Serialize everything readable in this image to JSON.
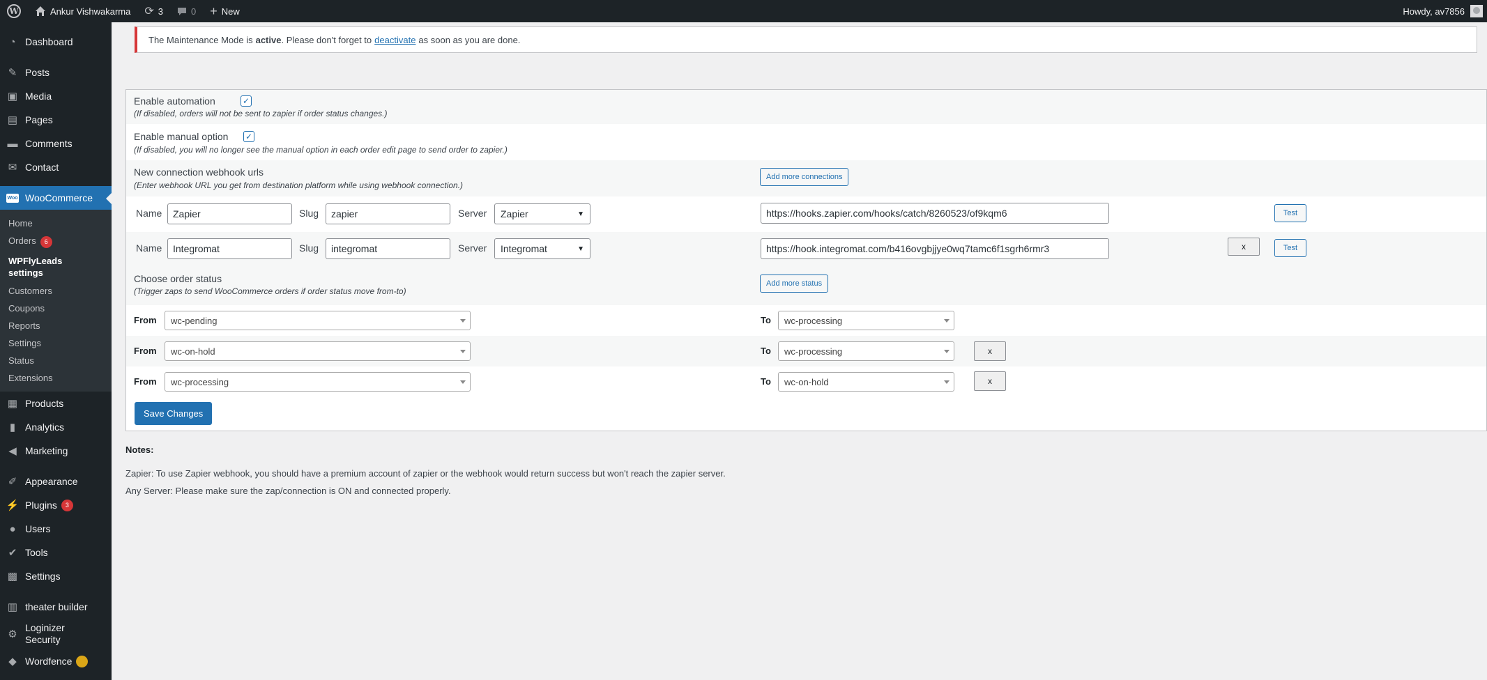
{
  "adminbar": {
    "site_name": "Ankur Vishwakarma",
    "updates_count": "3",
    "comments_count": "0",
    "new_label": "New",
    "howdy": "Howdy, av7856"
  },
  "sidebar": {
    "items_top": [
      {
        "label": "Dashboard",
        "icon": "dashboard-icon"
      }
    ],
    "items_content": [
      {
        "label": "Posts",
        "icon": "pin-icon"
      },
      {
        "label": "Media",
        "icon": "media-icon"
      },
      {
        "label": "Pages",
        "icon": "page-icon"
      },
      {
        "label": "Comments",
        "icon": "comment-icon"
      },
      {
        "label": "Contact",
        "icon": "mail-icon"
      }
    ],
    "woocommerce_label": "WooCommerce",
    "woo_icon_text": "Woo",
    "woo_submenu": {
      "home": "Home",
      "orders": "Orders",
      "orders_badge": "6",
      "wpflyleads": "WPFlyLeads settings",
      "customers": "Customers",
      "coupons": "Coupons",
      "reports": "Reports",
      "settings": "Settings",
      "status": "Status",
      "extensions": "Extensions"
    },
    "items_store": [
      {
        "label": "Products",
        "icon": "archive-icon"
      },
      {
        "label": "Analytics",
        "icon": "chart-icon"
      },
      {
        "label": "Marketing",
        "icon": "megaphone-icon"
      }
    ],
    "appearance": "Appearance",
    "plugins": "Plugins",
    "plugins_badge": "3",
    "users": "Users",
    "tools": "Tools",
    "settings": "Settings",
    "theater_builder": "theater builder",
    "loginizer": "Loginizer Security",
    "wordfence": "Wordfence"
  },
  "notice": {
    "prefix": "The Maintenance Mode is",
    "active": "active",
    "middle": ". Please don't forget to",
    "link": "deactivate",
    "suffix": "as soon as you are done."
  },
  "form": {
    "enable_automation_label": "Enable automation",
    "enable_automation_hint": "(If disabled, orders will not be sent to zapier if order status changes.)",
    "enable_automation_checked": true,
    "enable_manual_label": "Enable manual option",
    "enable_manual_hint": "(If disabled, you will no longer see the manual option in each order edit page to send order to zapier.)",
    "enable_manual_checked": true,
    "webhook_label": "New connection webhook urls",
    "webhook_hint": "(Enter webhook URL you get from destination platform while using webhook connection.)",
    "add_connections": "Add more connections",
    "name_label": "Name",
    "slug_label": "Slug",
    "server_label": "Server",
    "test_label": "Test",
    "remove_label": "x",
    "connections": [
      {
        "name": "Zapier",
        "slug": "zapier",
        "server": "Zapier",
        "url": "https://hooks.zapier.com/hooks/catch/8260523/of9kqm6"
      },
      {
        "name": "Integromat",
        "slug": "integromat",
        "server": "Integromat",
        "url": "https://hook.integromat.com/b416ovgbjjye0wq7tamc6f1sgrh6rmr3"
      }
    ],
    "order_status_label": "Choose order status",
    "order_status_hint": "(Trigger zaps to send WooCommerce orders if order status move from-to)",
    "add_status": "Add more status",
    "from_label": "From",
    "to_label": "To",
    "transitions": [
      {
        "from": "wc-pending",
        "to": "wc-processing"
      },
      {
        "from": "wc-on-hold",
        "to": "wc-processing"
      },
      {
        "from": "wc-processing",
        "to": "wc-on-hold"
      }
    ],
    "save": "Save Changes"
  },
  "notes": {
    "title": "Notes:",
    "line1": "Zapier: To use Zapier webhook, you should have a premium account of zapier or the webhook would return success but won't reach the zapier server.",
    "line2": "Any Server: Please make sure the zap/connection is ON and connected properly."
  }
}
